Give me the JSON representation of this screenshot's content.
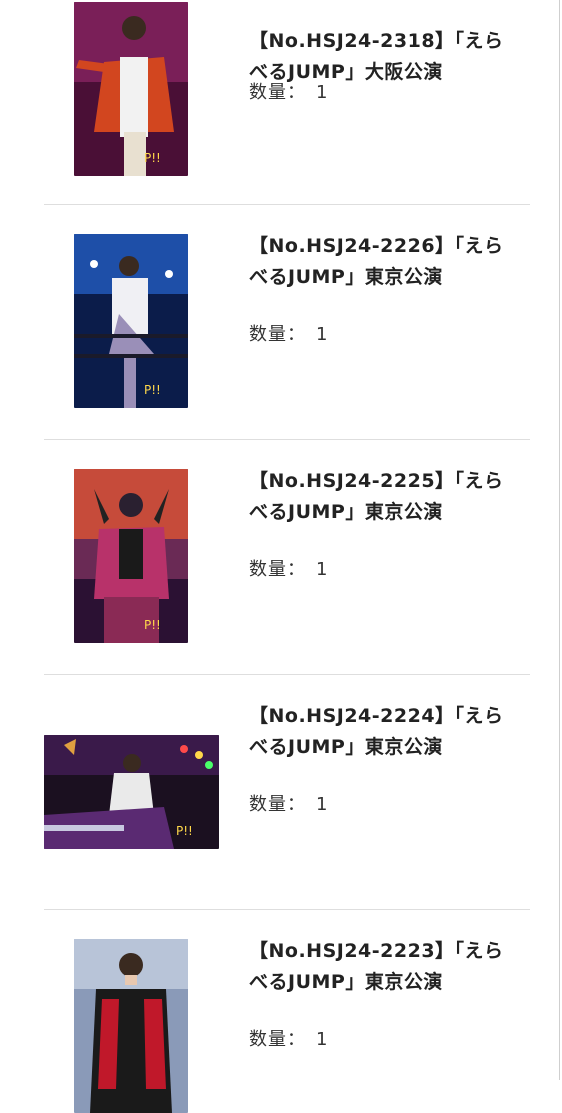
{
  "items": [
    {
      "title": "【No.HSJ24-2318】「えらべるJUMP」大阪公演",
      "qty_label": "数量：",
      "qty_value": "1",
      "thumb": {
        "orientation": "portrait",
        "colors": [
          "#5a1440",
          "#8d2a63",
          "#e2542a"
        ]
      }
    },
    {
      "title": "【No.HSJ24-2226】「えらべるJUMP」東京公演",
      "qty_label": "数量：",
      "qty_value": "1",
      "thumb": {
        "orientation": "portrait",
        "colors": [
          "#0b1c4a",
          "#1e4fa8",
          "#e9e9ef"
        ]
      }
    },
    {
      "title": "【No.HSJ24-2225】「えらべるJUMP」東京公演",
      "qty_label": "数量：",
      "qty_value": "1",
      "thumb": {
        "orientation": "portrait",
        "colors": [
          "#2b1133",
          "#c64b3a",
          "#b8326a"
        ]
      }
    },
    {
      "title": "【No.HSJ24-2224】「えらべるJUMP」東京公演",
      "qty_label": "数量：",
      "qty_value": "1",
      "thumb": {
        "orientation": "landscape",
        "colors": [
          "#1b1020",
          "#5a2a72",
          "#eaeaea"
        ]
      }
    },
    {
      "title": "【No.HSJ24-2223】「えらべるJUMP」東京公演",
      "qty_label": "数量：",
      "qty_value": "1",
      "thumb": {
        "orientation": "portrait",
        "colors": [
          "#8a9ab8",
          "#b8c4d8",
          "#c0182a"
        ]
      }
    }
  ]
}
